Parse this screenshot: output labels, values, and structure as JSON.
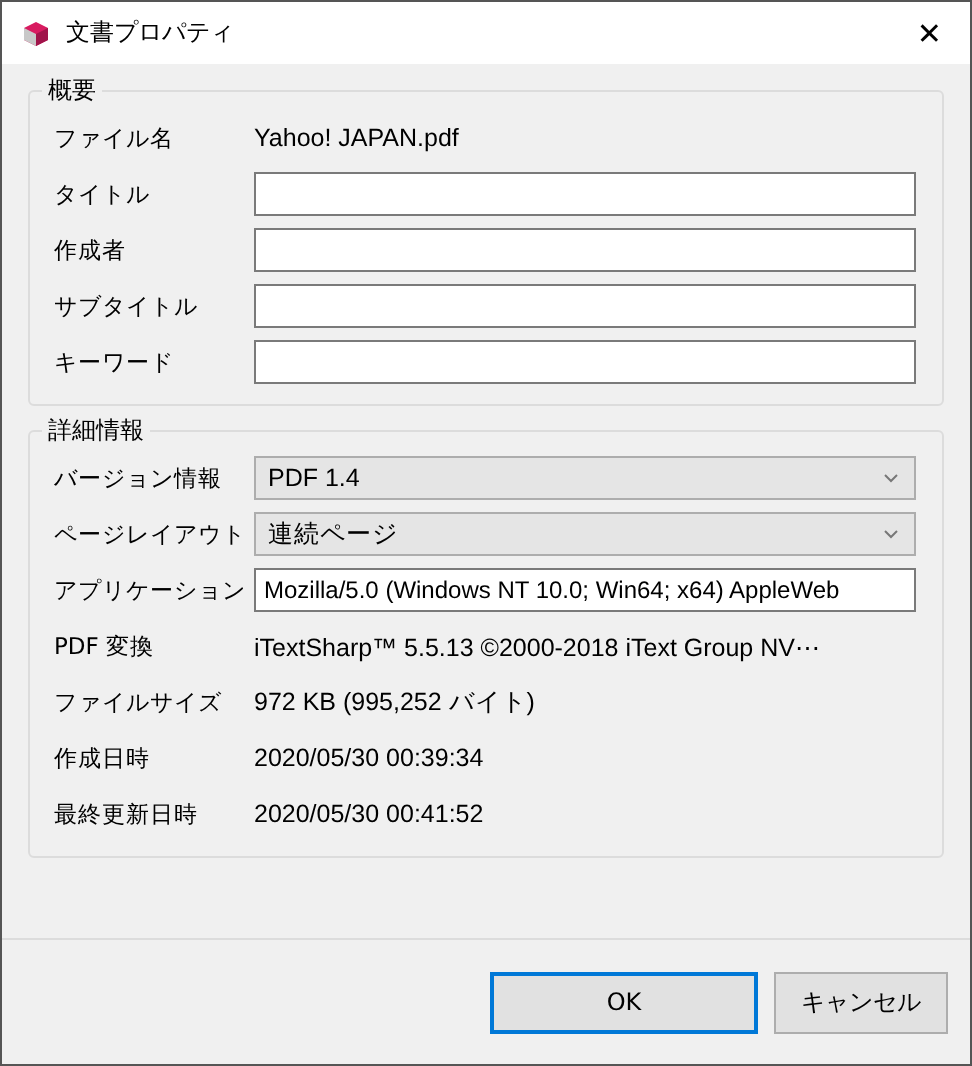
{
  "window": {
    "title": "文書プロパティ",
    "close": "✕"
  },
  "groups": [
    {
      "title": "概要",
      "rows": [
        {
          "kind": "text",
          "label": "ファイル名",
          "value": "Yahoo! JAPAN.pdf"
        },
        {
          "kind": "input",
          "label": "タイトル"
        },
        {
          "kind": "input",
          "label": "作成者"
        },
        {
          "kind": "input",
          "label": "サブタイトル"
        },
        {
          "kind": "input",
          "label": "キーワード"
        }
      ]
    },
    {
      "title": "詳細情報",
      "rows": [
        {
          "kind": "select",
          "label": "バージョン情報",
          "value": "PDF 1.4"
        },
        {
          "kind": "select",
          "label": "ページレイアウト",
          "value": "連続ページ"
        },
        {
          "kind": "input",
          "label": "アプリケーション",
          "value": "Mozilla/5.0 (Windows NT 10.0; Win64; x64) AppleWeb"
        },
        {
          "kind": "text",
          "label": "PDF 変換",
          "value": "iTextSharp™ 5.5.13 ©2000-2018 iText Group NV⋯"
        },
        {
          "kind": "text",
          "label": "ファイルサイズ",
          "value": "972 KB (995,252 バイト)"
        },
        {
          "kind": "text",
          "label": "作成日時",
          "value": "2020/05/30 00:39:34"
        },
        {
          "kind": "text",
          "label": "最終更新日時",
          "value": "2020/05/30 00:41:52"
        }
      ]
    }
  ],
  "buttons": [
    {
      "label": "OK",
      "selected": true
    },
    {
      "label": "キャンセル",
      "selected": false
    }
  ]
}
